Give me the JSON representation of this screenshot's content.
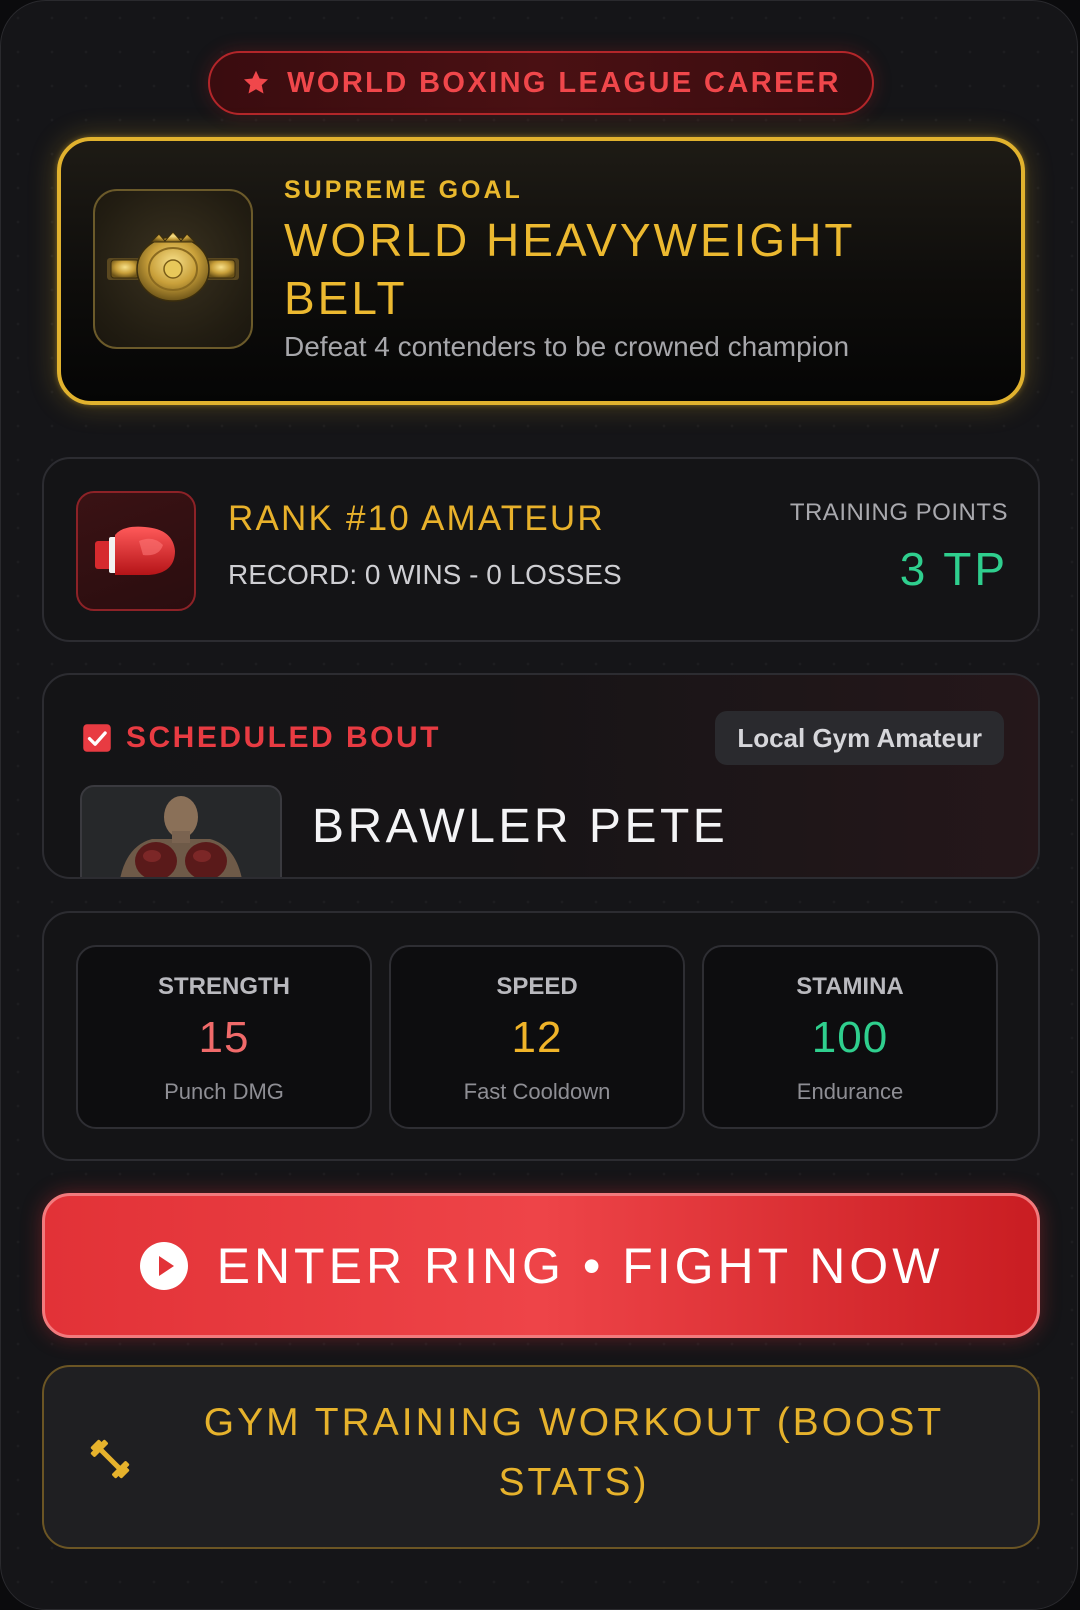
{
  "header": {
    "title": "WORLD BOXING LEAGUE CAREER",
    "icon": "star-icon"
  },
  "goal": {
    "eyebrow": "SUPREME GOAL",
    "title": "WORLD HEAVYWEIGHT BELT",
    "description": "Defeat 4 contenders to be crowned champion",
    "icon": "championship-belt-icon",
    "accent_color": "#e1b22e"
  },
  "career": {
    "rank": "RANK #10 AMATEUR",
    "record": "RECORD: 0 WINS - 0 LOSSES",
    "training_points_label": "TRAINING POINTS",
    "training_points_value": "3 TP",
    "icon": "boxing-glove-icon"
  },
  "bout": {
    "label": "SCHEDULED BOUT",
    "tier": "Local Gym Amateur",
    "opponent": "BRAWLER PETE",
    "icon": "checkbox-checked-icon"
  },
  "stats": [
    {
      "name": "STRENGTH",
      "value": "15",
      "sub": "Punch DMG",
      "color": "#f06a6a"
    },
    {
      "name": "SPEED",
      "value": "12",
      "sub": "Fast Cooldown",
      "color": "#f0b429"
    },
    {
      "name": "STAMINA",
      "value": "100",
      "sub": "Endurance",
      "color": "#2fcf8e"
    }
  ],
  "actions": {
    "fight_label": "ENTER RING • FIGHT NOW",
    "fight_icon": "play-circle-icon",
    "gym_label": "GYM TRAINING WORKOUT (BOOST STATS)",
    "gym_icon": "dumbbell-icon"
  },
  "colors": {
    "background": "#151518",
    "danger": "#e83b42",
    "gold": "#e8b12b",
    "success": "#2fcf8e"
  }
}
